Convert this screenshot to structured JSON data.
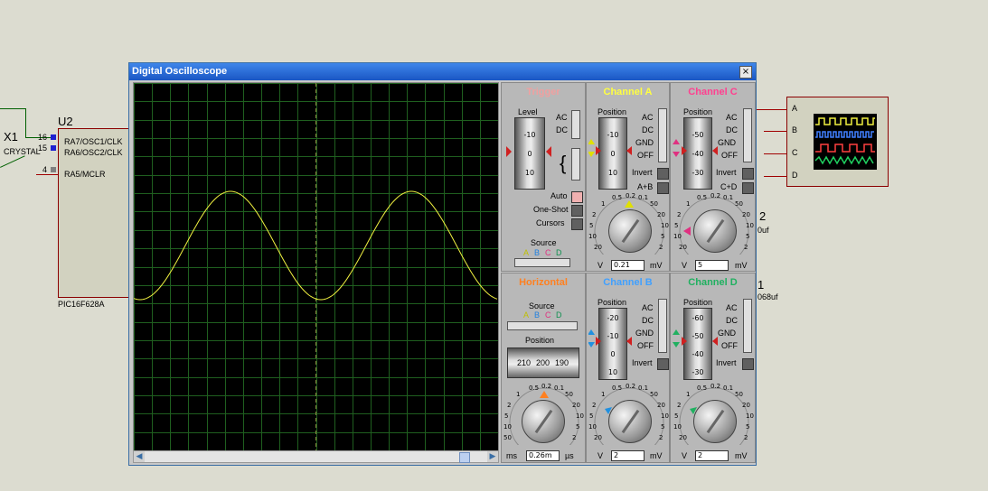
{
  "window": {
    "title": "Digital Oscilloscope",
    "close_label": "×"
  },
  "schematic": {
    "x1": "X1",
    "crystal": "CRYSTAL",
    "u2": "U2",
    "pin16": "16",
    "pin15": "15",
    "pin4": "4",
    "ra7": "RA7/OSC1/CLK",
    "ra6": "RA6/OSC2/CLK",
    "ra5": "RA5/MCLR",
    "chip": "PIC16F628A",
    "c2_label": "2",
    "c2_val": "0uf",
    "c1_label": "1",
    "c1_val": "068uf",
    "scope_pins": [
      "A",
      "B",
      "C",
      "D"
    ]
  },
  "trigger": {
    "title": "Trigger",
    "level": "Level",
    "ac": "AC",
    "dc": "DC",
    "level_ticks": [
      "-10",
      "0",
      "10"
    ],
    "auto": "Auto",
    "oneshot": "One-Shot",
    "cursors": "Cursors",
    "source": "Source",
    "sources": [
      "A",
      "B",
      "C",
      "D"
    ]
  },
  "channel_a": {
    "title": "Channel A",
    "position": "Position",
    "ticks": [
      "-10",
      "0",
      "10"
    ],
    "modes": [
      "AC",
      "DC",
      "GND",
      "OFF"
    ],
    "invert": "Invert",
    "extra": "A+B",
    "value": "0.21",
    "unit_left": "V",
    "unit_right": "mV"
  },
  "channel_c": {
    "title": "Channel C",
    "position": "Position",
    "ticks": [
      "-50",
      "-40",
      "-30"
    ],
    "modes": [
      "AC",
      "DC",
      "GND",
      "OFF"
    ],
    "invert": "Invert",
    "extra": "C+D",
    "value": "5",
    "unit_left": "V",
    "unit_right": "mV"
  },
  "horizontal": {
    "title": "Horizontal",
    "source": "Source",
    "sources": [
      "A",
      "B",
      "C",
      "D"
    ],
    "position": "Position",
    "pos_ticks": [
      "210",
      "200",
      "190"
    ],
    "value": "0.26m",
    "unit_left": "ms",
    "unit_right": "µs"
  },
  "channel_b": {
    "title": "Channel B",
    "position": "Position",
    "ticks": [
      "-20",
      "-10",
      "0",
      "10"
    ],
    "modes": [
      "AC",
      "DC",
      "GND",
      "OFF"
    ],
    "invert": "Invert",
    "value": "2",
    "unit_left": "V",
    "unit_right": "mV"
  },
  "channel_d": {
    "title": "Channel D",
    "position": "Position",
    "ticks": [
      "-60",
      "-50",
      "-40",
      "-30"
    ],
    "modes": [
      "AC",
      "DC",
      "GND",
      "OFF"
    ],
    "invert": "Invert",
    "value": "2",
    "unit_left": "V",
    "unit_right": "mV"
  },
  "colors": {
    "trace": "#f0f040",
    "grid": "#1f5f1f",
    "channel_a": "#ffff40",
    "channel_b": "#40a0ff",
    "channel_c": "#ff4090",
    "channel_d": "#20b060",
    "horizontal": "#ff8020"
  }
}
